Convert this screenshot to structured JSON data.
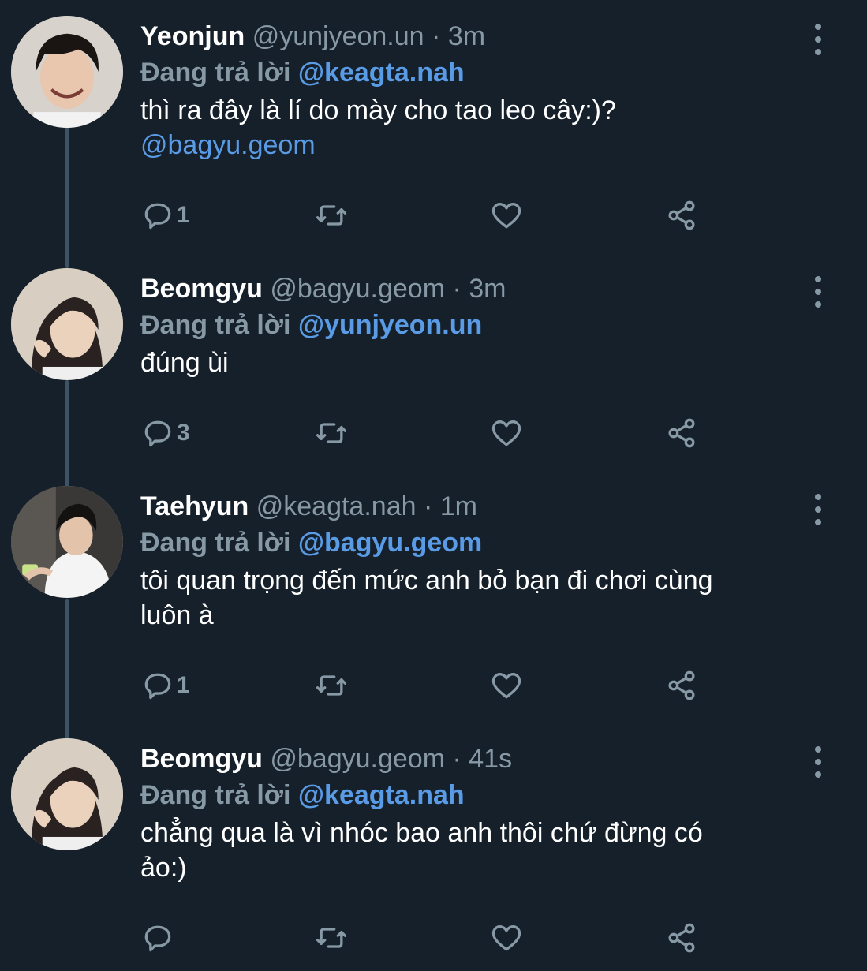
{
  "tweets": [
    {
      "name": "Yeonjun",
      "handle": "@yunjyeon.un",
      "separator": "·",
      "time": "3m",
      "reply_prefix": "Đang trả lời",
      "reply_to": "@keagta.nah",
      "text": "thì ra đây là lí do mày cho tao leo cây:)?",
      "mention": "@bagyu.geom",
      "reply_count": "1"
    },
    {
      "name": "Beomgyu",
      "handle": "@bagyu.geom",
      "separator": "·",
      "time": "3m",
      "reply_prefix": "Đang trả lời",
      "reply_to": "@yunjyeon.un",
      "text": "đúng ùi",
      "reply_count": "3"
    },
    {
      "name": "Taehyun",
      "handle": "@keagta.nah",
      "separator": "·",
      "time": "1m",
      "reply_prefix": "Đang trả lời",
      "reply_to": "@bagyu.geom",
      "text_line1": "tôi quan trọng đến mức anh bỏ bạn đi chơi cùng",
      "text_line2": "luôn à",
      "reply_count": "1"
    },
    {
      "name": "Beomgyu",
      "handle": "@bagyu.geom",
      "separator": "·",
      "time": "41s",
      "reply_prefix": "Đang trả lời",
      "reply_to": "@keagta.nah",
      "text_line1": "chẳng qua là vì nhóc bao anh thôi chứ đừng có",
      "text_line2": "ảo:)",
      "reply_count": ""
    }
  ],
  "icons": {
    "reply": "reply-icon",
    "retweet": "retweet-icon",
    "like": "heart-icon",
    "share": "share-icon",
    "more": "more-vertical-icon"
  },
  "colors": {
    "background": "#15202b",
    "secondary_text": "#8899a6",
    "link": "#5a9be6",
    "thread_line": "#3d5466"
  }
}
